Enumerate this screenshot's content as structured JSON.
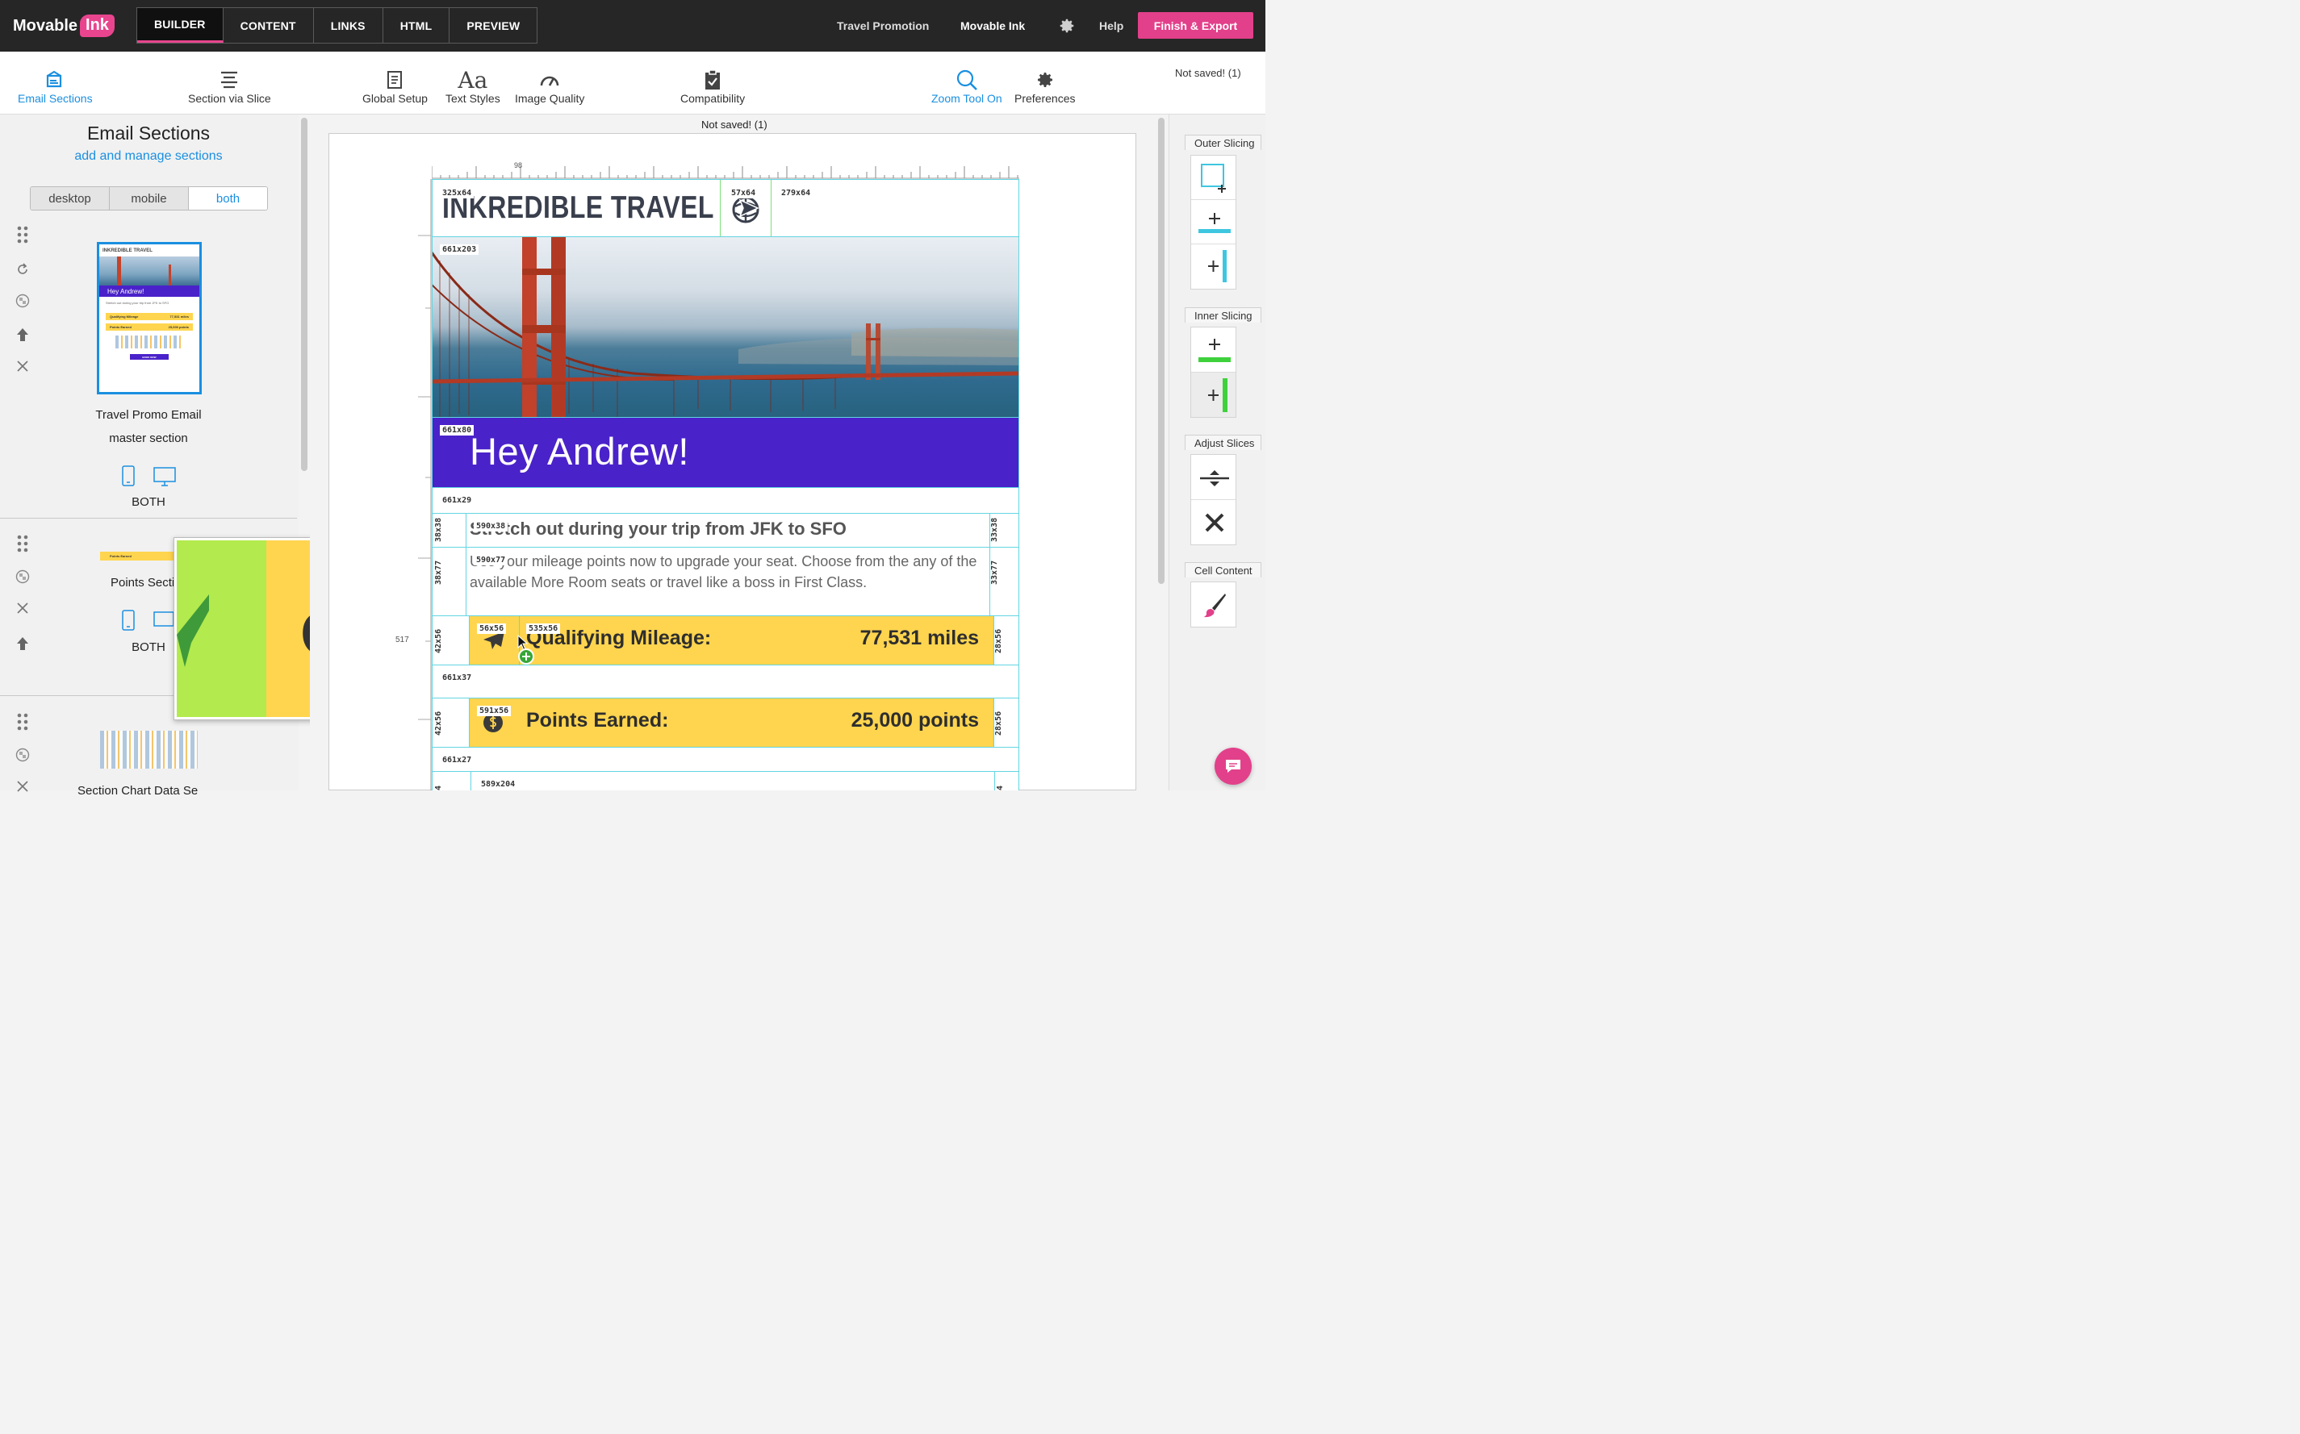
{
  "app": {
    "logo_text": "Movable",
    "logo_ink": "Ink"
  },
  "nav": {
    "tabs": [
      {
        "label": "BUILDER"
      },
      {
        "label": "CONTENT"
      },
      {
        "label": "LINKS"
      },
      {
        "label": "HTML"
      },
      {
        "label": "PREVIEW"
      }
    ],
    "active_tab": "BUILDER",
    "campaign": "Travel Promotion",
    "company": "Movable Ink",
    "help": "Help",
    "finish_label": "Finish & Export"
  },
  "toolbar": {
    "email_sections": "Email Sections",
    "section_via_slice": "Section via Slice",
    "global_setup": "Global Setup",
    "text_styles": "Text Styles",
    "text_styles_glyph": "Aa",
    "image_quality": "Image Quality",
    "compatibility": "Compatibility",
    "zoom_tool": "Zoom Tool On",
    "preferences": "Preferences",
    "not_saved": "Not saved! (1)"
  },
  "left_panel": {
    "title": "Email Sections",
    "subtitle": "add and manage sections",
    "view_options": [
      "desktop",
      "mobile",
      "both"
    ],
    "selected_view": "both",
    "sections": [
      {
        "name": "Travel Promo Email",
        "type": "master section",
        "device": "BOTH"
      },
      {
        "name": "Points Secti",
        "device": "BOTH"
      },
      {
        "name": "Section Chart Data Se"
      }
    ]
  },
  "canvas": {
    "not_saved": "Not saved! (1)",
    "ruler_mark": "98",
    "ruler_y_mark": "517",
    "email": {
      "logo_text": "INKREDIBLE TRAVEL",
      "greeting": "Hey Andrew!",
      "headline": "Stretch out during your trip from JFK to SFO",
      "body": "Use your mileage points now to upgrade your seat. Choose from the any of the available More Room seats or travel like a boss in First Class.",
      "mileage_label": "Qualifying Mileage:",
      "mileage_value": "77,531 miles",
      "points_label": "Points Earned:",
      "points_value": "25,000 points",
      "thumb_logo": "INKREDIBLE TRAVEL",
      "thumb_greeting": "Hey Andrew!",
      "thumb_body": "Stretch out during your trip from JFK to SFO",
      "thumb_row1_label": "Qualifying Mileage",
      "thumb_row1_value": "77,531 miles",
      "thumb_row2_label": "Points Earned",
      "thumb_row2_value": "25,000 points",
      "thumb_cta": "BOOK NOW",
      "thumb2_label": "Points Earned"
    },
    "slice_dims": {
      "logo": "325x64",
      "icon": "57x64",
      "right": "279x64",
      "hero": "661x203",
      "greeting": "661x80",
      "spacer1": "661x29",
      "left38": "38x38",
      "headline": "590x38",
      "right33": "33x38",
      "left77": "38x77",
      "body": "590x77",
      "right77": "33x77",
      "left56": "42x56",
      "iconcell": "56x56",
      "mileage": "535x56",
      "right56": "28x56",
      "spacer2": "661x37",
      "left56b": "42x56",
      "points": "591x56",
      "right56b": "28x56",
      "spacer3": "661x27",
      "left204": "4",
      "bottom": "589x204",
      "right204": "4"
    }
  },
  "right_panel": {
    "outer_slicing": "Outer Slicing",
    "inner_slicing": "Inner Slicing",
    "adjust_slices": "Adjust Slices",
    "cell_content": "Cell Content"
  },
  "colors": {
    "brand_pink": "#e2408a",
    "accent_blue": "#1a8fe0",
    "slice_cyan": "#63d5e2",
    "greeting_purple": "#4a22c9",
    "row_yellow": "#ffd54f",
    "zoom_green": "#b3ea4d"
  }
}
